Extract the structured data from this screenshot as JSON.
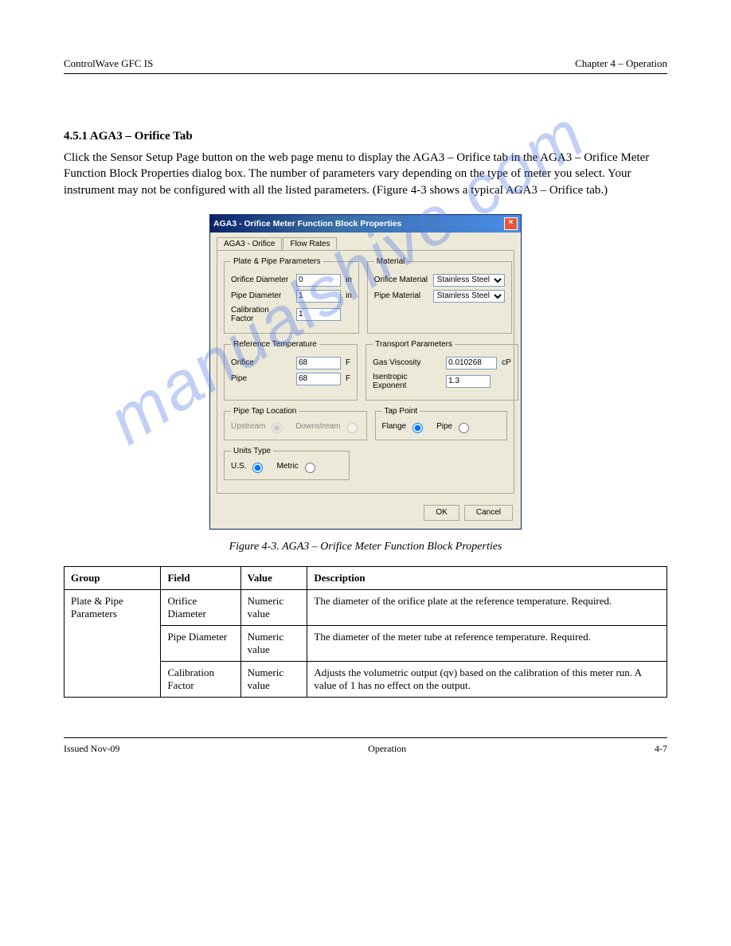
{
  "header": {
    "left": "ControlWave GFC IS",
    "right": "Chapter 4 – Operation"
  },
  "section": {
    "number_title": "4.5.1 AGA3 – Orifice Tab",
    "intro": "Click the Sensor Setup Page button on the web page menu to display the AGA3 – Orifice tab in the AGA3 – Orifice Meter Function Block Properties dialog box. The number of parameters vary depending on the type of meter you select. Your instrument may not be configured with all the listed parameters. (Figure 4-3 shows a typical AGA3 – Orifice tab.)"
  },
  "dialog": {
    "title": "AGA3 - Orifice Meter Function Block Properties",
    "tabs": [
      "AGA3 - Orifice",
      "Flow Rates"
    ],
    "groups": {
      "plate_pipe": {
        "legend": "Plate & Pipe Parameters",
        "orifice_diameter_label": "Orifice Diameter",
        "orifice_diameter_value": "0",
        "orifice_diameter_unit": "in",
        "pipe_diameter_label": "Pipe Diameter",
        "pipe_diameter_value": "1",
        "pipe_diameter_unit": "in",
        "calibration_factor_label": "Calibration Factor",
        "calibration_factor_value": "1"
      },
      "material": {
        "legend": "Material",
        "orifice_material_label": "Orifice Material",
        "orifice_material_value": "Stainless Steel",
        "pipe_material_label": "Pipe Material",
        "pipe_material_value": "Stainless Steel"
      },
      "ref_temp": {
        "legend": "Reference Temperature",
        "orifice_label": "Orifice",
        "orifice_value": "68",
        "orifice_unit": "F",
        "pipe_label": "Pipe",
        "pipe_value": "68",
        "pipe_unit": "F"
      },
      "transport": {
        "legend": "Transport Parameters",
        "gas_viscosity_label": "Gas Viscosity",
        "gas_viscosity_value": "0.010268",
        "gas_viscosity_unit": "cP",
        "isentropic_label": "Isentropic Exponent",
        "isentropic_value": "1.3"
      },
      "pipe_tap": {
        "legend": "Pipe Tap Location",
        "upstream": "Upstream",
        "downstream": "Downstream"
      },
      "tap_point": {
        "legend": "Tap Point",
        "flange": "Flange",
        "pipe": "Pipe"
      },
      "units": {
        "legend": "Units Type",
        "us": "U.S.",
        "metric": "Metric"
      }
    },
    "buttons": {
      "ok": "OK",
      "cancel": "Cancel"
    }
  },
  "figure_caption": "Figure 4-3. AGA3 – Orifice Meter Function Block Properties",
  "table": {
    "headers": [
      "Group",
      "Field",
      "Value",
      "Description"
    ],
    "rows": [
      {
        "group": "Plate & Pipe Parameters",
        "field": "Orifice Diameter",
        "value": "Numeric value",
        "desc": "The diameter of the orifice plate at the reference temperature. Required."
      },
      {
        "group": "",
        "field": "Pipe Diameter",
        "value": "Numeric value",
        "desc": "The diameter of the meter tube at reference temperature. Required."
      },
      {
        "group": "",
        "field": "Calibration Factor",
        "value": "Numeric value",
        "desc": "Adjusts the volumetric output (qv) based on the calibration of this meter run. A value of 1 has no effect on the output."
      }
    ]
  },
  "footer": {
    "left": "Issued Nov-09",
    "center": "Operation",
    "right": "4-7"
  },
  "watermark": "manualshive.com"
}
